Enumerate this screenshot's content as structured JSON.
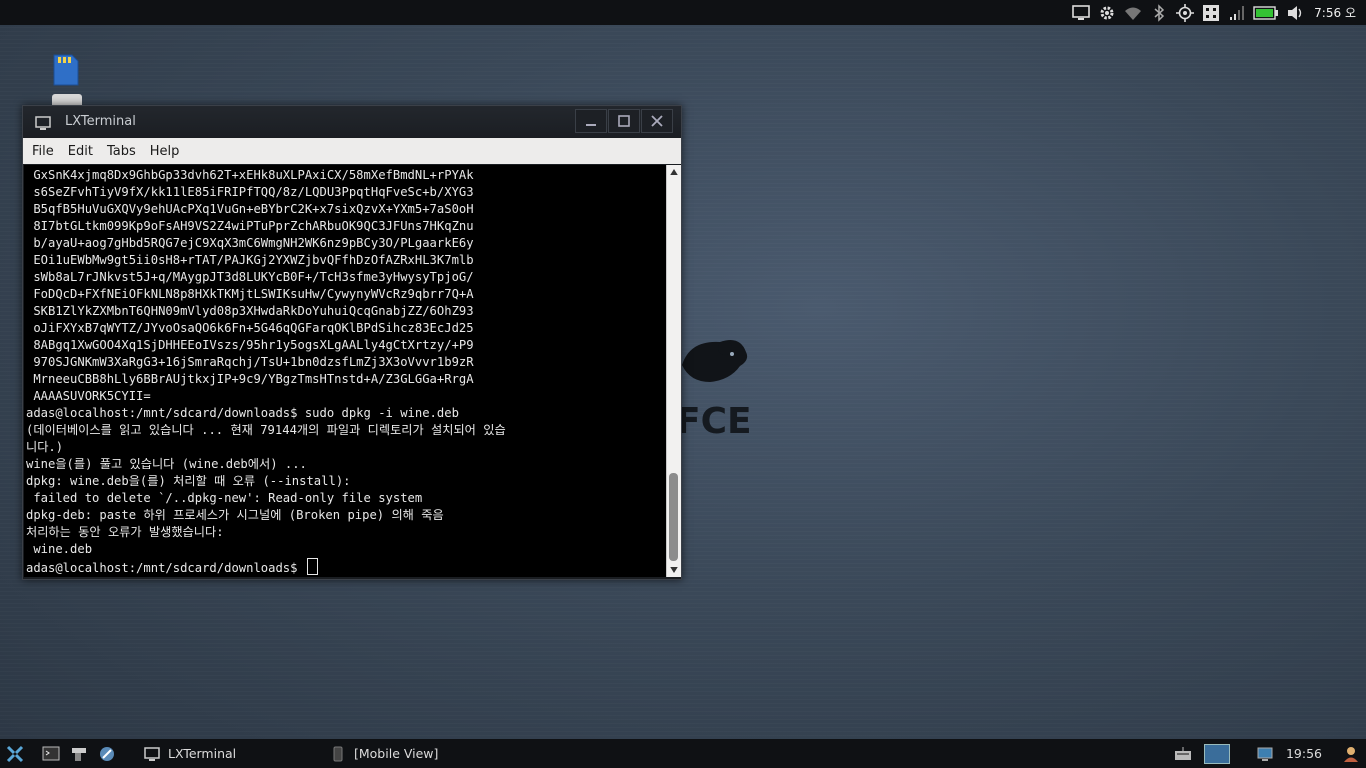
{
  "top_panel": {
    "clock": "7:56",
    "clock_suffix": "오",
    "icons": [
      "network-monitor-icon",
      "settings-gear-icon",
      "wifi-icon",
      "bluetooth-icon",
      "gps-icon",
      "app-grid-icon",
      "signal-icon",
      "battery-icon",
      "volume-icon"
    ]
  },
  "window": {
    "title": "LXTerminal",
    "menu": [
      "File",
      "Edit",
      "Tabs",
      "Help"
    ],
    "terminal_lines": [
      " GxSnK4xjmq8Dx9GhbGp33dvh62T+xEHk8uXLPAxiCX/58mXefBmdNL+rPYAk",
      " s6SeZFvhTiyV9fX/kk11lE85iFRIPfTQQ/8z/LQDU3PpqtHqFveSc+b/XYG3",
      " B5qfB5HuVuGXQVy9ehUAcPXq1VuGn+eBYbrC2K+x7sixQzvX+YXm5+7aS0oH",
      " 8I7btGLtkm099Kp9oFsAH9VS2Z4wiPTuPprZchARbuOK9QC3JFUns7HKqZnu",
      " b/ayaU+aog7gHbd5RQG7ejC9XqX3mC6WmgNH2WK6nz9pBCy3O/PLgaarkE6y",
      " EOi1uEWbMw9gt5ii0sH8+rTAT/PAJKGj2YXWZjbvQFfhDzOfAZRxHL3K7mlb",
      " sWb8aL7rJNkvst5J+q/MAygpJT3d8LUKYcB0F+/TcH3sfme3yHwysyTpjoG/",
      " FoDQcD+FXfNEiOFkNLN8p8HXkTKMjtLSWIKsuHw/CywynyWVcRz9qbrr7Q+A",
      " SKB1ZlYkZXMbnT6QHN09mVlyd08p3XHwdaRkDoYuhuiQcqGnabjZZ/6OhZ93",
      " oJiFXYxB7qWYTZ/JYvoOsaQO6k6Fn+5G46qQGFarqOKlBPdSihcz83EcJd25",
      " 8ABgq1XwGOO4Xq1SjDHHEEoIVszs/95hr1y5ogsXLgAALly4gCtXrtzy/+P9",
      " 970SJGNKmW3XaRgG3+16jSmraRqchj/TsU+1bn0dzsfLmZj3X3oVvvr1b9zR",
      " MrneeuCBB8hLly6BBrAUjtkxjIP+9c9/YBgzTmsHTnstd+A/Z3GLGGa+RrgA",
      " AAAASUVORK5CYII=",
      "adas@localhost:/mnt/sdcard/downloads$ sudo dpkg -i wine.deb",
      "(데이터베이스를 읽고 있습니다 ... 현재 79144개의 파일과 디렉토리가 설치되어 있습",
      "니다.)",
      "wine을(를) 풀고 있습니다 (wine.deb에서) ...",
      "dpkg: wine.deb을(를) 처리할 때 오류 (--install):",
      " failed to delete `/..dpkg-new': Read-only file system",
      "dpkg-deb: paste 하위 프로세스가 시그널에 (Broken pipe) 의해 죽음",
      "처리하는 동안 오류가 발생했습니다:",
      " wine.deb",
      "adas@localhost:/mnt/sdcard/downloads$ "
    ]
  },
  "bottom_panel": {
    "tasks": [
      {
        "label": "LXTerminal"
      },
      {
        "label": "[Mobile View]"
      }
    ],
    "clock": "19:56"
  },
  "colors": {
    "desktop": "#3a4858",
    "panel": "#0f1114",
    "terminal_bg": "#000000",
    "terminal_fg": "#e8e8e8",
    "battery": "#34c234"
  }
}
